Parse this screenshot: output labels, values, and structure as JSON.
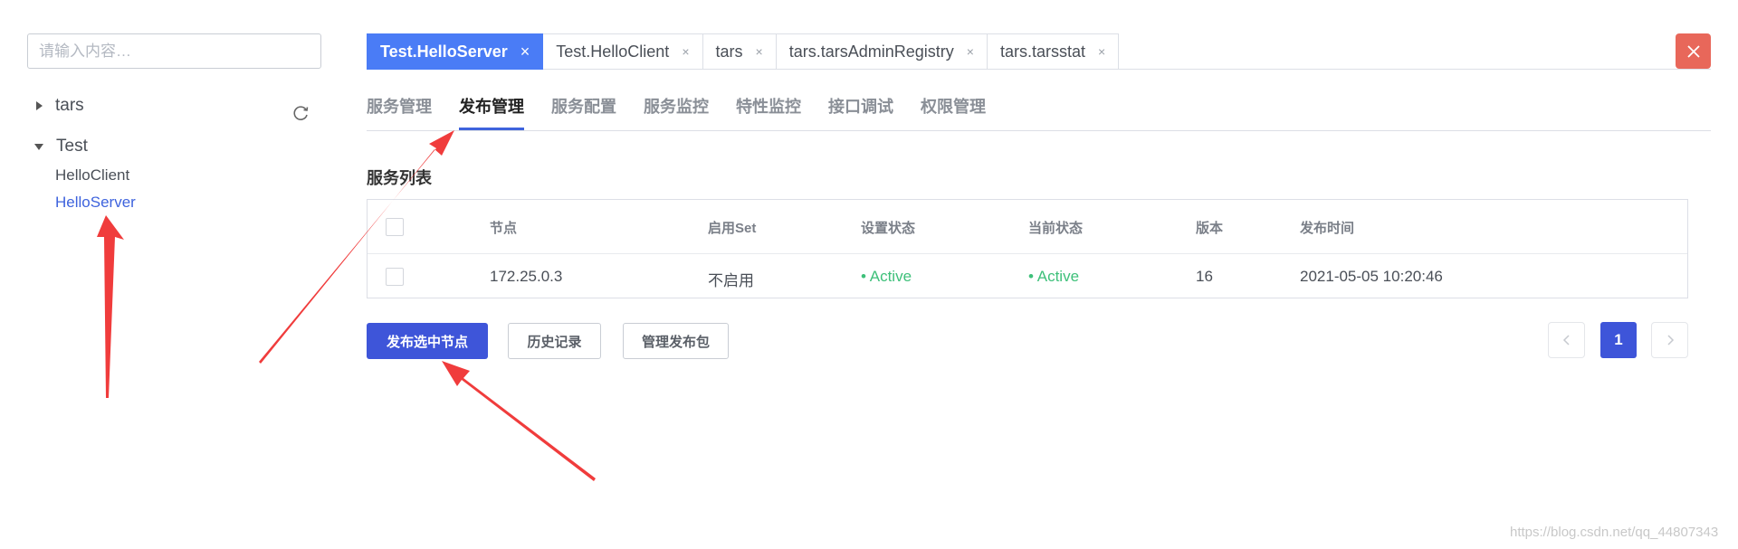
{
  "sidebar": {
    "search_placeholder": "请输入内容…",
    "tree": [
      {
        "label": "tars",
        "expanded": false
      },
      {
        "label": "Test",
        "expanded": true,
        "children": [
          "HelloClient",
          "HelloServer"
        ]
      }
    ],
    "active_leaf": "HelloServer"
  },
  "tabs": [
    {
      "label": "Test.HelloServer",
      "active": true
    },
    {
      "label": "Test.HelloClient",
      "active": false
    },
    {
      "label": "tars",
      "active": false
    },
    {
      "label": "tars.tarsAdminRegistry",
      "active": false
    },
    {
      "label": "tars.tarsstat",
      "active": false
    }
  ],
  "tab_close_symbol": "×",
  "subnav": [
    "服务管理",
    "发布管理",
    "服务配置",
    "服务监控",
    "特性监控",
    "接口调试",
    "权限管理"
  ],
  "subnav_active": "发布管理",
  "section_title": "服务列表",
  "table": {
    "headers": [
      "节点",
      "启用Set",
      "设置状态",
      "当前状态",
      "版本",
      "发布时间"
    ],
    "rows": [
      [
        "172.25.0.3",
        "不启用",
        "• Active",
        "• Active",
        "16",
        "2021-05-05 10:20:46"
      ]
    ]
  },
  "buttons": {
    "publish_selected": "发布选中节点",
    "history": "历史记录",
    "manage_packages": "管理发布包"
  },
  "pagination": {
    "current_page": "1"
  },
  "watermark": "https://blog.csdn.net/qq_44807343",
  "colors": {
    "accent": "#3e55d9",
    "tab_active": "#4a7cf6",
    "status_active": "#3ec07a",
    "close_button": "#e8675a",
    "annotation_arrow": "#f03c3c"
  },
  "icons": [
    "refresh-icon",
    "close-icon",
    "chevron-left-icon",
    "chevron-right-icon",
    "triangle-right-icon",
    "triangle-down-icon"
  ]
}
